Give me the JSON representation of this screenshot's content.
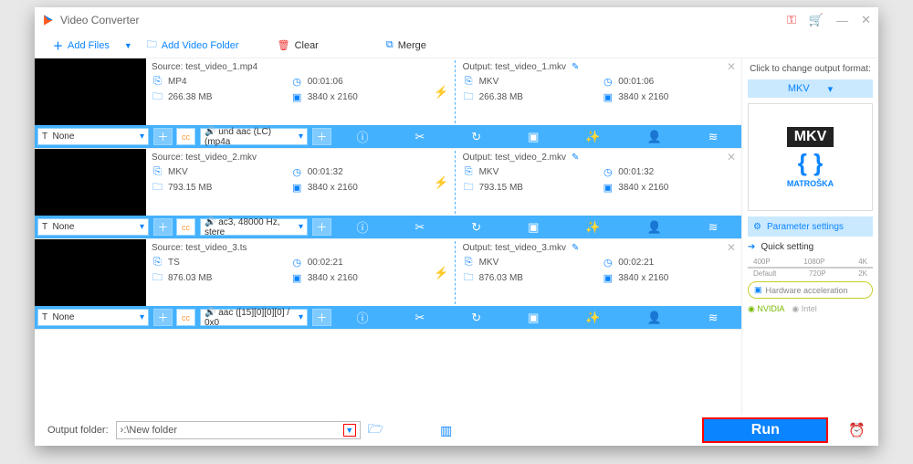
{
  "app": {
    "title": "Video Converter"
  },
  "toolbar": {
    "add_files": "Add Files",
    "add_folder": "Add Video Folder",
    "clear": "Clear",
    "merge": "Merge"
  },
  "items": [
    {
      "src_label": "Source: test_video_1.mp4",
      "src_fmt": "MP4",
      "src_dur": "00:01:06",
      "src_size": "266.38 MB",
      "src_res": "3840 x 2160",
      "out_label": "Output: test_video_1.mkv",
      "out_fmt": "MKV",
      "out_dur": "00:01:06",
      "out_size": "266.38 MB",
      "out_res": "3840 x 2160",
      "track": "None",
      "audio": "und aac (LC) (mp4a"
    },
    {
      "src_label": "Source: test_video_2.mkv",
      "src_fmt": "MKV",
      "src_dur": "00:01:32",
      "src_size": "793.15 MB",
      "src_res": "3840 x 2160",
      "out_label": "Output: test_video_2.mkv",
      "out_fmt": "MKV",
      "out_dur": "00:01:32",
      "out_size": "793.15 MB",
      "out_res": "3840 x 2160",
      "track": "None",
      "audio": "ac3, 48000 Hz, stere"
    },
    {
      "src_label": "Source: test_video_3.ts",
      "src_fmt": "TS",
      "src_dur": "00:02:21",
      "src_size": "876.03 MB",
      "src_res": "3840 x 2160",
      "out_label": "Output: test_video_3.mkv",
      "out_fmt": "MKV",
      "out_dur": "00:02:21",
      "out_size": "876.03 MB",
      "out_res": "3840 x 2160",
      "track": "None",
      "audio": "aac ([15][0][0][0] / 0x0"
    }
  ],
  "side": {
    "hdr": "Click to change output format:",
    "format": "MKV",
    "matroska": "MATROŠKA",
    "param": "Parameter settings",
    "quick": "Quick setting",
    "scale_top": [
      "400P",
      "1080P",
      "4K"
    ],
    "scale_bottom": [
      "Default",
      "720P",
      "2K"
    ],
    "hw": "Hardware acceleration",
    "nvidia": "NVIDIA",
    "intel": "Intel"
  },
  "bottom": {
    "label": "Output folder:",
    "path": "›:\\New folder",
    "run": "Run"
  }
}
